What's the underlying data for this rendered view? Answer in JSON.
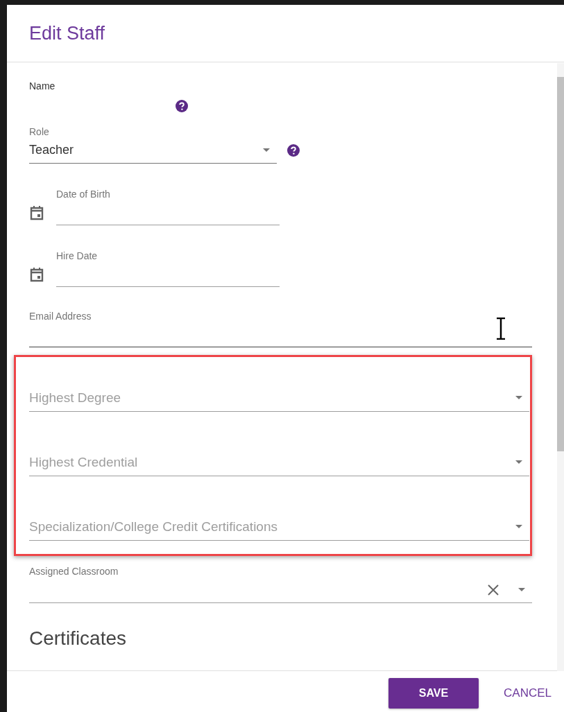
{
  "dialog": {
    "title": "Edit Staff"
  },
  "fields": [
    {
      "kind": "help-text",
      "label": "Name",
      "help": true
    },
    {
      "kind": "select",
      "label": "Role",
      "value": "Teacher",
      "help": true
    },
    {
      "kind": "date",
      "label": "Date of Birth"
    },
    {
      "kind": "date",
      "label": "Hire Date"
    },
    {
      "kind": "text",
      "label": "Email Address"
    },
    {
      "kind": "group",
      "highlighted": true,
      "fields": [
        {
          "kind": "select",
          "placeholder": "Highest Degree"
        },
        {
          "kind": "select",
          "placeholder": "Highest Credential"
        },
        {
          "kind": "select",
          "placeholder": "Specialization/College Credit Certifications"
        }
      ]
    },
    {
      "kind": "select",
      "label": "Assigned Classroom",
      "clearable": true
    }
  ],
  "section_heading": "Certificates",
  "actions": [
    {
      "kind": "primary",
      "label": "SAVE"
    },
    {
      "kind": "flat",
      "label": "CANCEL"
    }
  ]
}
